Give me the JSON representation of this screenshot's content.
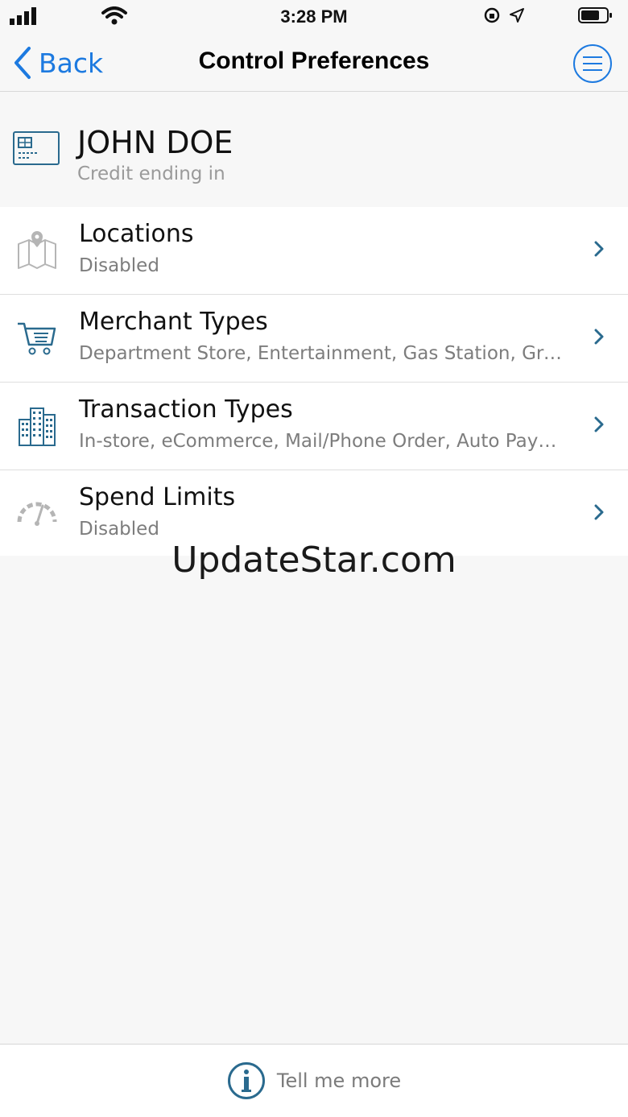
{
  "status_bar": {
    "time": "3:28 PM"
  },
  "nav": {
    "back_label": "Back",
    "title": "Control Preferences"
  },
  "card": {
    "name": "JOHN DOE",
    "subtitle": "Credit ending in"
  },
  "list": {
    "items": [
      {
        "icon": "map-pin-icon",
        "title": "Locations",
        "subtitle": "Disabled"
      },
      {
        "icon": "shopping-cart-icon",
        "title": "Merchant Types",
        "subtitle": "Department Store, Entertainment, Gas Station, Grocery"
      },
      {
        "icon": "buildings-icon",
        "title": "Transaction Types",
        "subtitle": "In-store, eCommerce, Mail/Phone Order, Auto Pay, ATM"
      },
      {
        "icon": "speedometer-icon",
        "title": "Spend Limits",
        "subtitle": "Disabled"
      }
    ]
  },
  "watermark": "UpdateStar.com",
  "footer": {
    "label": "Tell me more"
  },
  "colors": {
    "accent": "#1d7ae0",
    "icon_dark": "#2a6a8e",
    "icon_gray": "#b5b5b5"
  }
}
